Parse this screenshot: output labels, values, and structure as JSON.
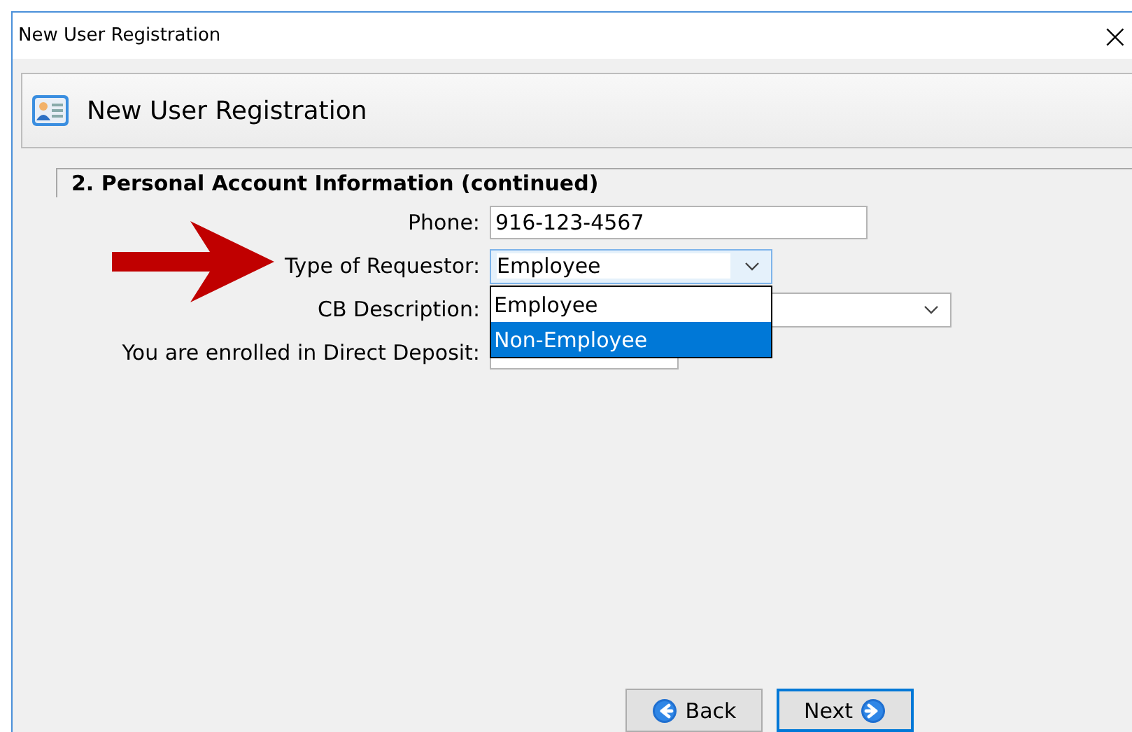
{
  "window": {
    "title": "New User Registration",
    "close": "×"
  },
  "header": {
    "title": "New User Registration"
  },
  "section": {
    "title": "2. Personal Account Information (continued)"
  },
  "fields": [
    {
      "kind": "text",
      "label": "Phone:",
      "value": "916-123-4567"
    },
    {
      "kind": "combo",
      "label": "Type of Requestor:",
      "value": "Employee",
      "expanded": true,
      "options": [
        {
          "label": "Employee",
          "highlighted": false
        },
        {
          "label": "Non-Employee",
          "highlighted": true
        }
      ]
    },
    {
      "kind": "combo",
      "label": "CB Description:",
      "expanded": false
    },
    {
      "kind": "short",
      "label": "You are enrolled in Direct Deposit:"
    }
  ],
  "buttons": [
    {
      "kind": "back",
      "label": "Back",
      "focused": false
    },
    {
      "kind": "next",
      "label": "Next",
      "focused": true
    }
  ]
}
